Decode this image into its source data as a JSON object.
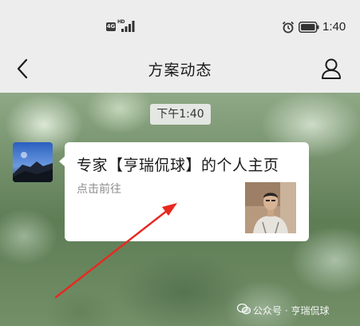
{
  "status_bar": {
    "network": "4G",
    "hd": "HD",
    "time": "1:40"
  },
  "nav": {
    "title": "方案动态",
    "back_icon": "chevron-left-icon",
    "profile_icon": "person-icon"
  },
  "chat": {
    "timestamp": "下午1:40",
    "card": {
      "title": "专家【亨瑞侃球】的个人主页",
      "subtitle": "点击前往"
    }
  },
  "watermark": "公众号 · 亨瑞侃球",
  "colors": {
    "bubble": "#ffffff",
    "bar": "#ededed",
    "arrow": "#e8281f"
  }
}
